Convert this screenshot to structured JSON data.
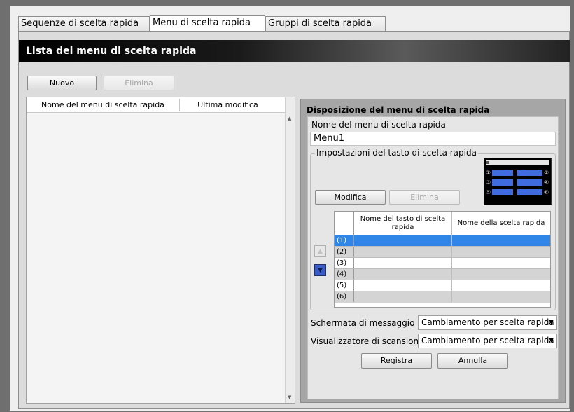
{
  "tabs": [
    {
      "label": "Sequenze di scelta rapida",
      "active": false
    },
    {
      "label": "Menu di scelta rapida",
      "active": true
    },
    {
      "label": "Gruppi di scelta rapida",
      "active": false
    }
  ],
  "header": {
    "title": "Lista dei menu di scelta rapida"
  },
  "list_toolbar": {
    "new_label": "Nuovo",
    "delete_label": "Elimina"
  },
  "menu_list": {
    "columns": [
      "Nome del menu di scelta rapida",
      "Ultima modifica"
    ],
    "rows": []
  },
  "layout_panel": {
    "title": "Disposizione del menu di scelta rapida",
    "menu_name_label": "Nome del menu di scelta rapida",
    "menu_name_value": "Menu1",
    "key_settings": {
      "legend": "Impostazioni del tasto di scelta rapida",
      "edit_label": "Modifica",
      "delete_label": "Elimina",
      "preview_numbers": [
        "①",
        "②",
        "③",
        "④",
        "⑤",
        "⑥"
      ],
      "table": {
        "columns": [
          "Nome del tasto di scelta rapida",
          "Nome della scelta rapida"
        ],
        "rows": [
          {
            "num": "(1)",
            "key_name": "",
            "shortcut_name": "",
            "selected": true
          },
          {
            "num": "(2)",
            "key_name": "",
            "shortcut_name": ""
          },
          {
            "num": "(3)",
            "key_name": "",
            "shortcut_name": ""
          },
          {
            "num": "(4)",
            "key_name": "",
            "shortcut_name": ""
          },
          {
            "num": "(5)",
            "key_name": "",
            "shortcut_name": ""
          },
          {
            "num": "(6)",
            "key_name": "",
            "shortcut_name": ""
          }
        ]
      }
    },
    "message_screen": {
      "label": "Schermata di messaggio",
      "value": "Cambiamento per scelta rapida"
    },
    "scan_viewer": {
      "label": "Visualizzatore di scansione",
      "value": "Cambiamento per scelta rapida"
    },
    "save_label": "Registra",
    "cancel_label": "Annulla"
  },
  "colors": {
    "selection": "#2f86e6",
    "preview_key": "#3f6de0",
    "move_button": "#3a5cc8"
  }
}
